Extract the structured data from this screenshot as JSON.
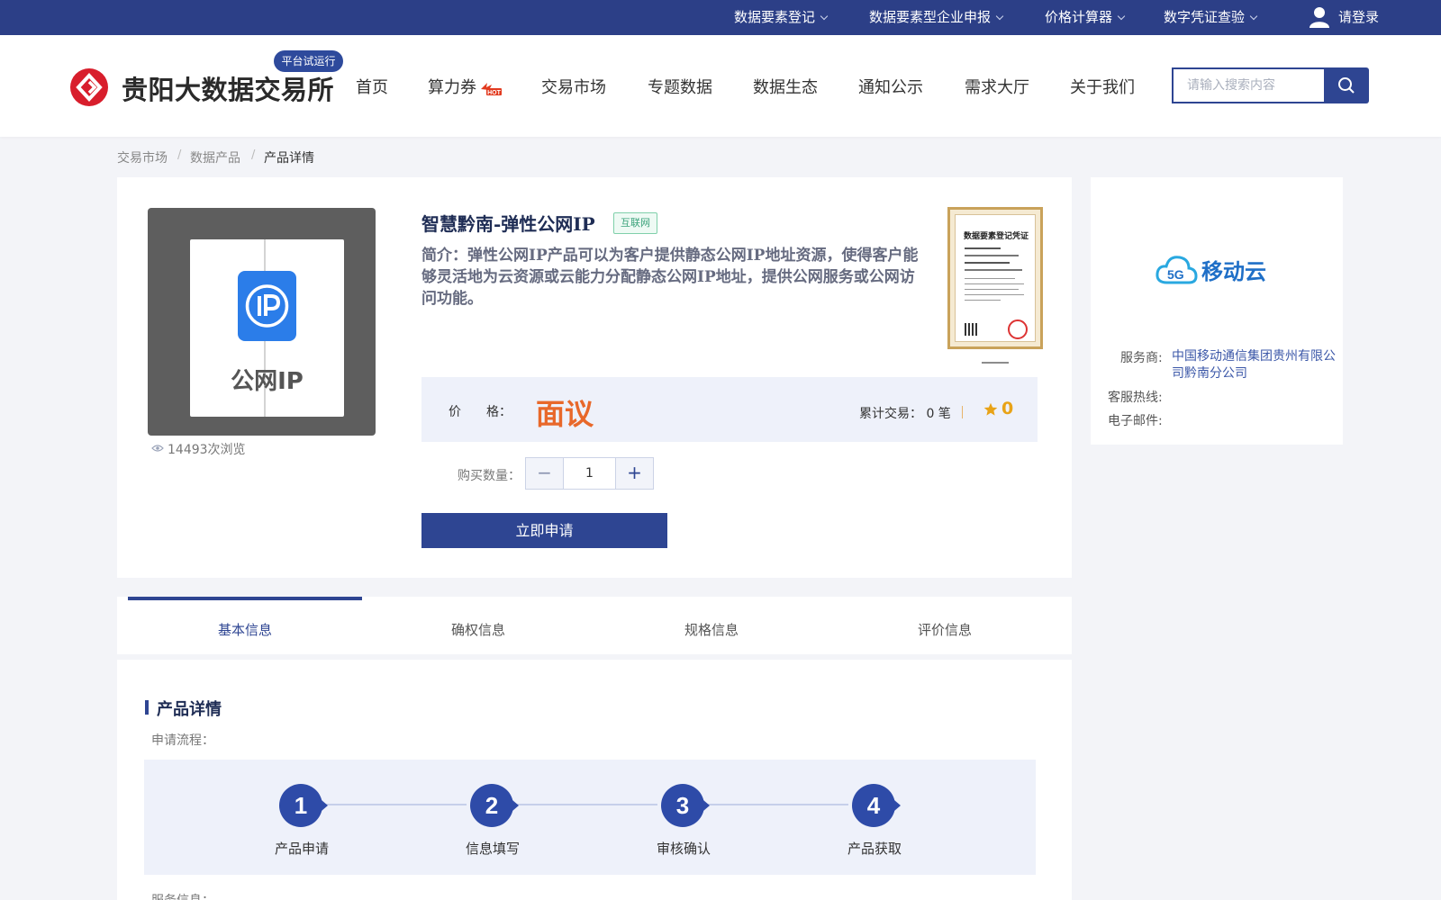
{
  "colors": {
    "primary": "#2e4592",
    "topbar": "#2c3f87",
    "price": "#e8682a",
    "rating": "#e8a317"
  },
  "topbar": {
    "links": [
      {
        "label": "数据要素登记"
      },
      {
        "label": "数据要素型企业申报"
      },
      {
        "label": "价格计算器"
      },
      {
        "label": "数字凭证查验"
      }
    ],
    "login": "请登录"
  },
  "header": {
    "logo_text": "贵阳大数据交易所",
    "trial_badge": "平台试运行",
    "nav": [
      {
        "label": "首页"
      },
      {
        "label": "算力券"
      },
      {
        "label": "交易市场"
      },
      {
        "label": "专题数据"
      },
      {
        "label": "数据生态"
      },
      {
        "label": "通知公示"
      },
      {
        "label": "需求大厅"
      },
      {
        "label": "关于我们"
      }
    ],
    "search_placeholder": "请输入搜索内容"
  },
  "breadcrumb": [
    "交易市场",
    "数据产品",
    "产品详情"
  ],
  "product": {
    "image_label": "公网IP",
    "views": "14493次浏览",
    "title": "智慧黔南-弹性公网IP",
    "tag": "互联网",
    "description": "简介：弹性公网IP产品可以为客户提供静态公网IP地址资源，使得客户能够灵活地为云资源或云能力分配静态公网IP地址，提供公网服务或公网访问功能。",
    "certificate_title": "数据要素登记凭证",
    "price_label": "价　　格：",
    "price": "面议",
    "trade_count": "累计交易： 0 笔",
    "rating": "0",
    "qty_label": "购买数量：",
    "quantity": "1",
    "minus": "−",
    "plus": "+",
    "apply_button": "立即申请"
  },
  "vendor": {
    "logo_text": "移动云",
    "logo_badge": "5G",
    "provider_label": "服务商:",
    "provider_name": "中国移动通信集团贵州有限公司黔南分公司",
    "hotline_label": "客服热线:",
    "email_label": "电子邮件:"
  },
  "tabs": [
    {
      "label": "基本信息"
    },
    {
      "label": "确权信息"
    },
    {
      "label": "规格信息"
    },
    {
      "label": "评价信息"
    }
  ],
  "details": {
    "section_title": "产品详情",
    "flow_label": "申请流程：",
    "steps": [
      {
        "num": "1",
        "name": "产品申请"
      },
      {
        "num": "2",
        "name": "信息填写"
      },
      {
        "num": "3",
        "name": "审核确认"
      },
      {
        "num": "4",
        "name": "产品获取"
      }
    ],
    "service_label": "服务信息："
  }
}
